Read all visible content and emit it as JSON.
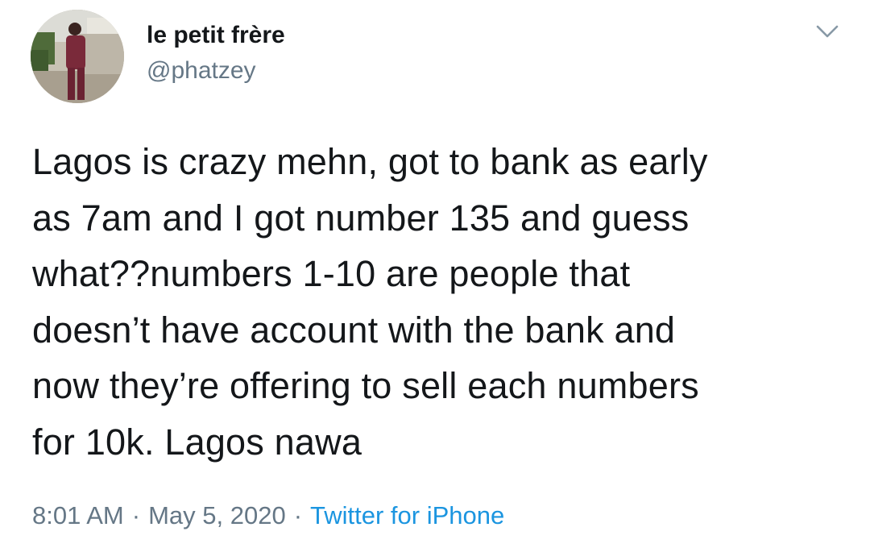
{
  "user": {
    "display_name": "le petit frère",
    "handle": "@phatzey"
  },
  "tweet": {
    "text_lines": [
      "Lagos is crazy mehn, got to bank as early",
      "as 7am and I got number 135 and guess",
      "what??numbers 1-10 are people that",
      "doesn’t have account with the bank and",
      "now they’re offering to sell each numbers",
      "for 10k. Lagos nawa"
    ],
    "time": "8:01 AM",
    "date": "May 5, 2020",
    "source": "Twitter for iPhone",
    "separator": "·"
  },
  "icons": {
    "menu": "chevron-down-icon",
    "avatar": "profile-photo"
  },
  "colors": {
    "text": "#14171a",
    "muted": "#657786",
    "link": "#1b95e0"
  }
}
